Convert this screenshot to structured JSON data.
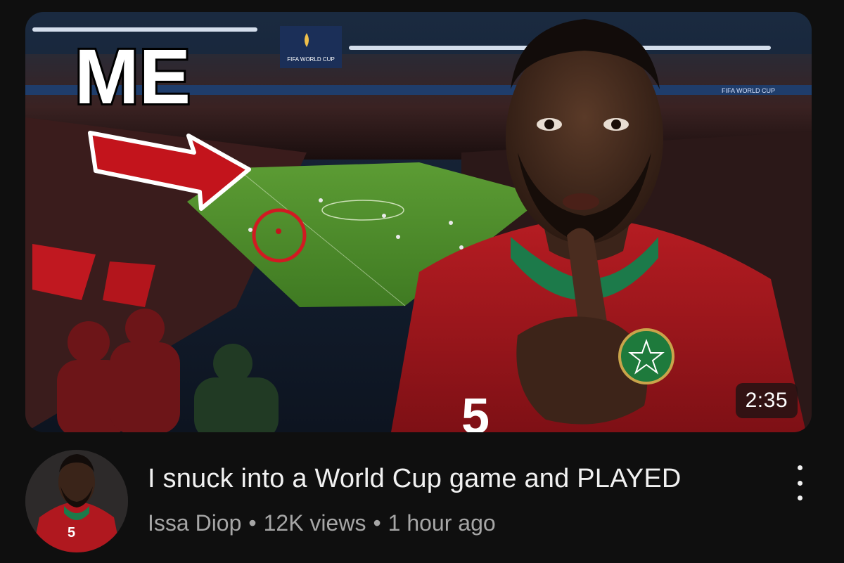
{
  "video": {
    "thumbnail": {
      "overlay_text": "ME",
      "banner_text": "FIFA WORLD CUP",
      "ad_board_text": "FIFA WORLD CUP",
      "jersey_number": "5",
      "duration": "2:35"
    },
    "title": "I snuck into a World Cup game and PLAYED",
    "channel": "Issa Diop",
    "views": "12K views",
    "age": "1 hour ago",
    "separator": "•"
  },
  "avatar": {
    "jersey_number": "5"
  },
  "colors": {
    "background": "#0f0f0f",
    "title": "#f1f1f1",
    "meta": "#a6a6a6",
    "jersey_red": "#a8161d",
    "arrow_red": "#c3141c",
    "pitch_green": "#4f8f2a"
  },
  "icons": {
    "more": "vertical-dots-icon"
  }
}
